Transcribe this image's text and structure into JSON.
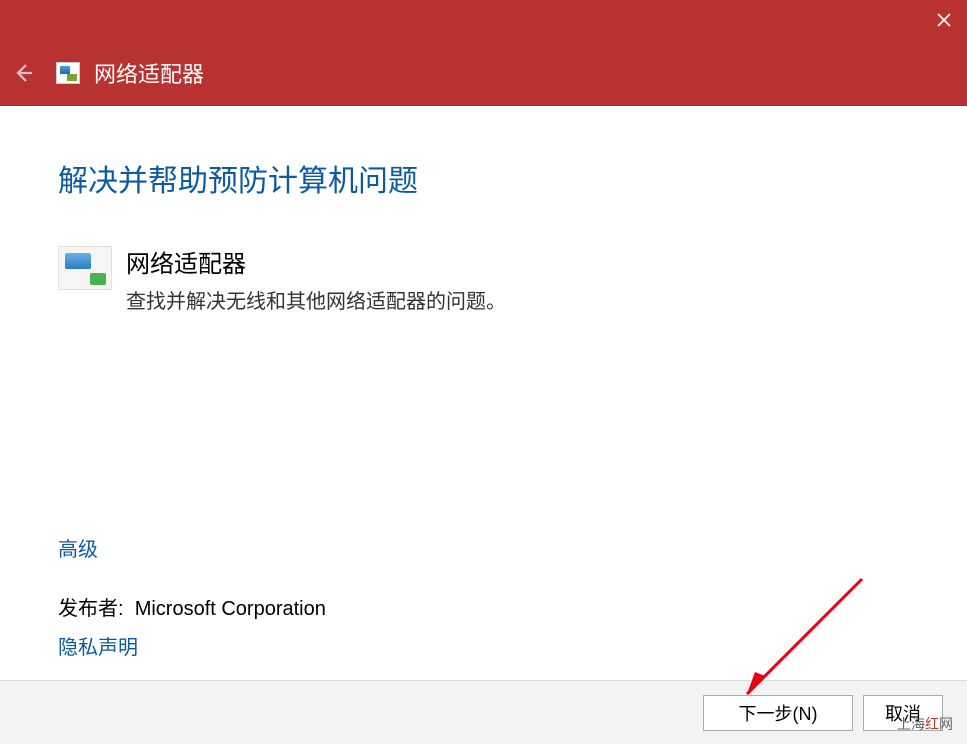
{
  "window": {
    "title": "网络适配器"
  },
  "headline": "解决并帮助预防计算机问题",
  "troubleshooter": {
    "title": "网络适配器",
    "description": "查找并解决无线和其他网络适配器的问题。"
  },
  "links": {
    "advanced": "高级",
    "privacy": "隐私声明"
  },
  "publisher": {
    "label": "发布者:",
    "name": "Microsoft Corporation"
  },
  "footer": {
    "next": "下一步(N)",
    "cancel": "取消"
  },
  "watermark": {
    "prefix": "上海",
    "red": "红",
    "suffix": "网"
  }
}
